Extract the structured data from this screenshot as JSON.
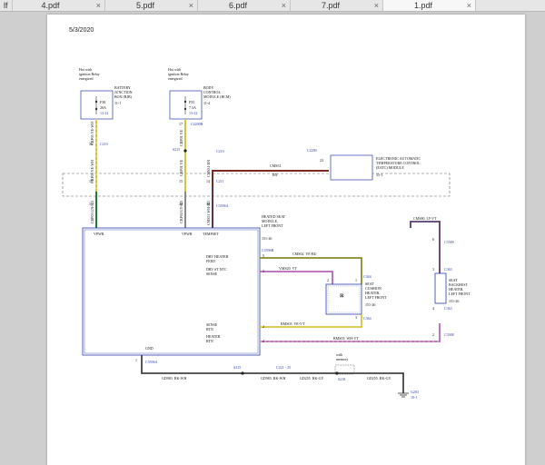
{
  "tabs": [
    {
      "label": "lf",
      "close": "×"
    },
    {
      "label": "4.pdf",
      "close": "×"
    },
    {
      "label": "5.pdf",
      "close": "×"
    },
    {
      "label": "6.pdf",
      "close": "×"
    },
    {
      "label": "7.pdf",
      "close": "×"
    },
    {
      "label": "1.pdf",
      "close": "×"
    }
  ],
  "page": {
    "date": "5/3/2020",
    "hot_left": "Hot with\nignition Relay\nenergized",
    "hot_right": "Hot with\nignition Relay\nenergized",
    "bjb": {
      "name": "BATTERY\nJUNCTION\nBOX (BJB)",
      "ref": "11-1",
      "fuse": "F38",
      "rating": "20A",
      "code": "13-22"
    },
    "bcm": {
      "name": "BODY\nCONTROL\nMODULE (BCM)",
      "ref": "11-4",
      "fuse": "F55",
      "rating": "7.5A",
      "code": "13-22"
    },
    "eatc": {
      "name": "ELECTRONIC AUTOMATIC\nTEMPERATURE CONTROL\n(EATC) MODULE",
      "ref": "55-1",
      "connector": "C2280",
      "pin": "23"
    },
    "module": {
      "name": "HEATED SEAT\nMODULE,\nLEFT FRONT",
      "ref": "151-26",
      "labels": [
        "VPWR",
        "VPWR",
        "TEMPSET",
        "DRV HEATER\nFEED",
        "DRV ST NTC\nSENSE",
        "SENSE\nRTN",
        "HEATER\nRTN",
        "GND"
      ],
      "connector_top": "C3596A",
      "connector_right": "C3596B",
      "connector_bot": "C3596A"
    },
    "cushion": {
      "name": "SEAT\nCUSHION\nHEATER,\nLEFT FRONT",
      "ref": "151-26",
      "c_top": "C364",
      "c_bot": "C364"
    },
    "backrest": {
      "name": "SEAT\nBACKREST\nHEATER,\nLEFT FRONT",
      "ref": "151-26",
      "c_top": "C363",
      "c_bot": "C363"
    },
    "wires": {
      "w1": {
        "circuit": "CBP05",
        "color": "YE-WH"
      },
      "w2": {
        "circuit": "CBP05",
        "color": "YE-WH"
      },
      "w3": {
        "circuit": "CBP03",
        "color": "GN-RD"
      },
      "w4": {
        "circuit": "CBP01",
        "color": "YE"
      },
      "w5": {
        "circuit": "CBP01",
        "color": "YE"
      },
      "w6": {
        "circuit": "CBP04",
        "color": "GY-RD"
      },
      "w7": {
        "circuit": "CMS51",
        "color": "BN"
      },
      "w8": {
        "circuit": "CMS51",
        "color": "BN"
      },
      "w9": {
        "circuit": "CMS51",
        "color": "WH-BU"
      },
      "w10": {
        "circuit": "CMS02",
        "color": "YE-BU"
      },
      "w11": {
        "circuit": "VMS20",
        "color": "VT"
      },
      "w12": {
        "circuit": "RMS03",
        "color": "VE-VT"
      },
      "w13": {
        "circuit": "RMS03",
        "color": "WH-VT"
      },
      "w14": {
        "circuit": "CMS80",
        "color": "LY-VT"
      },
      "w15": {
        "circuit": "GD983",
        "color": "BK-WH"
      },
      "w16": {
        "circuit": "GD983",
        "color": "BK-WH"
      },
      "w17": {
        "circuit": "GD255",
        "color": "BK-GY"
      },
      "w18": {
        "circuit": "GD255",
        "color": "BK-GY"
      }
    },
    "connectors": {
      "c2200b": "C2200B",
      "c210": "C210",
      "c211": "C211",
      "c2280": "C2280",
      "c3596a": "C3596A",
      "c3309": "C3309",
      "c363": "C363",
      "c3308": "C3308",
      "c364": "C364",
      "s215": "S215",
      "s215b": "S215",
      "s218": "S218",
      "c221": "C221 - 25",
      "c3280": "C3280",
      "c3596a_b": "C3596A"
    },
    "splice_note": "with\nmemory",
    "ground": {
      "name": "G203",
      "ref": "10-1"
    },
    "pins": [
      "36",
      "15",
      "17",
      "15",
      "14",
      "1",
      "12",
      "33",
      "3",
      "2",
      "1",
      "5",
      "2",
      "4",
      "1",
      "6",
      "4",
      "3",
      "1",
      "3",
      "2"
    ]
  }
}
